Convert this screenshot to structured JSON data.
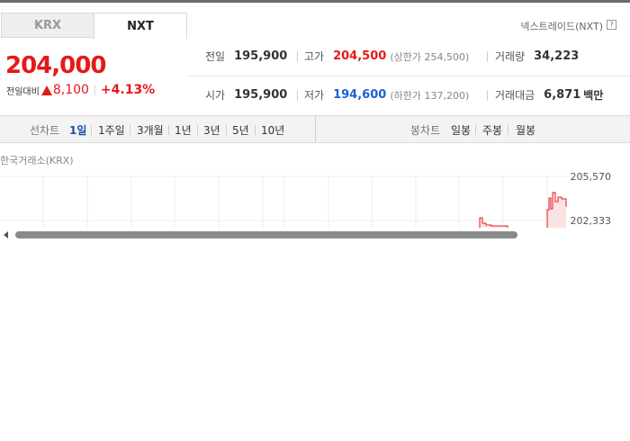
{
  "tabs": [
    {
      "label": "KRX",
      "active": false
    },
    {
      "label": "NXT",
      "active": true
    }
  ],
  "exchange_name": "넥스트레이드(NXT)",
  "help_icon": "?",
  "price": "204,000",
  "change": {
    "label": "전일대비",
    "direction": "up-triangle-icon",
    "value": "8,100",
    "percent": "+4.13%"
  },
  "stats": {
    "prev_close": {
      "label": "전일",
      "value": "195,900"
    },
    "high": {
      "label": "고가",
      "value": "204,500",
      "sub": "(상한가 254,500)"
    },
    "volume": {
      "label": "거래량",
      "value": "34,223"
    },
    "open": {
      "label": "시가",
      "value": "195,900"
    },
    "low": {
      "label": "저가",
      "value": "194,600",
      "sub": "(하한가 137,200)"
    },
    "amount": {
      "label": "거래대금",
      "value": "6,871",
      "unit": "백만"
    }
  },
  "period_bar": {
    "line_title": "선차트",
    "line_periods": [
      "1일",
      "1주일",
      "3개월",
      "1년",
      "3년",
      "5년",
      "10년"
    ],
    "active_period": "1일",
    "candle_title": "봉차트",
    "candle_periods": [
      "일봉",
      "주봉",
      "월봉"
    ]
  },
  "chart": {
    "exchange_label": "한국거래소(KRX)",
    "y_ticks": [
      "205,570",
      "202,333"
    ],
    "line_color": "#e8181a"
  },
  "colors": {
    "up": "#e8181a",
    "down": "#1a5fd8",
    "active": "#1a4fa8"
  }
}
